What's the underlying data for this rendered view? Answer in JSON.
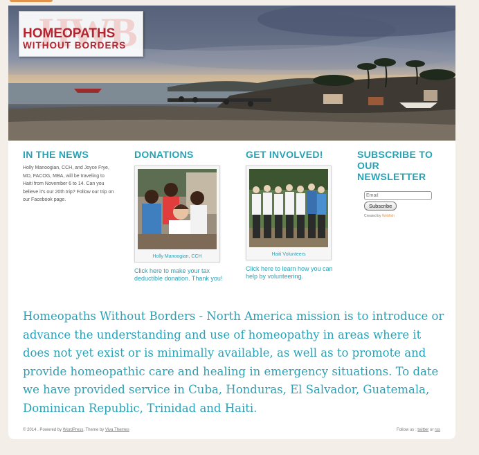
{
  "header": {
    "logo_bg_text": "HWB",
    "logo_line1": "HOMEOPATHS",
    "logo_line2": "WITHOUT BORDERS"
  },
  "news": {
    "title": "IN THE NEWS",
    "text": "Holly Manoogian, CCH, and Joyce Frye, MD, FACOG, MBA, will be traveling to Haiti from November 6 to 14. Can you believe it's our 20th trip? Follow our trip on our Facebook page."
  },
  "donations": {
    "title": "DONATIONS",
    "caption": "Holly Manoogian, CCH",
    "link": "Click here to make your tax deductible donation. Thank you!"
  },
  "involved": {
    "title": "GET INVOLVED!",
    "caption": "Haiti Volunteers",
    "link": "Click here to learn how you can help by volunteering."
  },
  "newsletter": {
    "title": "SUBSCRIBE TO OUR NEWSLETTER",
    "email_placeholder": "Email",
    "subscribe_label": "Subscribe",
    "created_by_prefix": "Created by",
    "created_by_brand": "Webfish"
  },
  "mission": "Homeopaths Without Borders - North America mission is to introduce or advance the understanding and use of homeopathy in areas where it does not yet exist or is minimally available, as well as to promote and provide homeopathic care and healing in emergency situations. To date we have provided service in Cuba, Honduras, El Salvador, Guatemala, Dominican Republic, Trinidad and Haiti.",
  "footer": {
    "left_prefix": "© 2014 . Powered by",
    "wordpress": "WordPress",
    "theme_prefix": ". Theme by",
    "theme_name": "Viva Themes",
    "follow_prefix": "Follow us :",
    "twitter": "twitter",
    "or": "or",
    "rss": "rss"
  },
  "colors": {
    "accent_teal": "#24a3b8",
    "logo_red": "#b3242f",
    "brand_orange": "#e0934a"
  }
}
